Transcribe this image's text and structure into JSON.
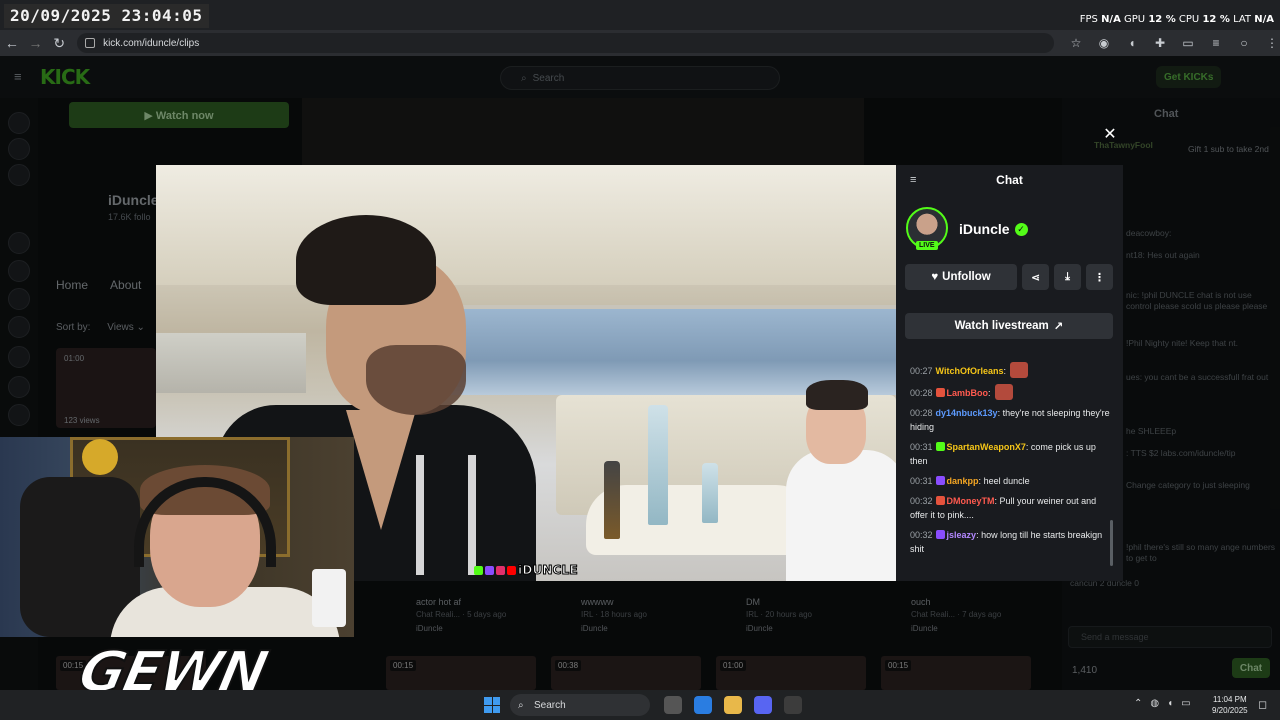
{
  "overlay": {
    "clock": "20/09/2025 23:04:05",
    "stats": {
      "fps_label": "FPS",
      "fps_value": "N/A",
      "gpu_label": "GPU",
      "gpu_value": "12 %",
      "cpu_label": "CPU",
      "cpu_value": "12 %",
      "lat_label": "LAT",
      "lat_value": "N/A"
    },
    "brand_text": "GEWN"
  },
  "browser": {
    "url": "kick.com/iduncle/clips"
  },
  "background_page": {
    "search_placeholder": "Search",
    "get_kicks": "Get KICKs",
    "watch_now": "▶ Watch now",
    "channel_name": "iDuncle",
    "channel_sub": "17.6K follo",
    "tabs": [
      "Home",
      "About"
    ],
    "sort_label": "Sort by:",
    "sort_value": "Views",
    "clip_duration_top": "01:00",
    "clip_views": "123 views",
    "clips": [
      {
        "title": "actor hot af",
        "meta": "Chat Reali... · 5 days ago",
        "author": "iDuncle"
      },
      {
        "title": "wwwww",
        "meta": "IRL · 18 hours ago",
        "author": "iDuncle"
      },
      {
        "title": "DM",
        "meta": "IRL · 20 hours ago",
        "author": "iDuncle"
      },
      {
        "title": "ouch",
        "meta": "Chat Reali... · 7 days ago",
        "author": "iDuncle"
      }
    ],
    "thumb_durations": [
      "00:15",
      "00:15",
      "00:38",
      "01:00",
      "00:15"
    ],
    "right_chat": {
      "title": "Chat",
      "gift_text": "Gift 1 sub to take 2nd",
      "top_user": "ThaTawnyFool",
      "messages": [
        "deacowboy:",
        "nt18: Hes out again",
        "nic: !phil DUNCLE chat is not use control please scold us please please",
        "!Phil Nighty nite! Keep that nt.",
        "ues: you cant be a successfull frat out",
        "he SHLEEEp",
        ": TTS $2 labs.com/iduncle/tip",
        "Change category to just sleeping",
        "!phil there's still so many ange numbers to get to",
        "cancun 2 duncle 0"
      ],
      "send_placeholder": "Send a message",
      "viewer_count": "1,410",
      "chat_button": "Chat"
    }
  },
  "modal": {
    "video_watermark": "iDUNCLE",
    "chat": {
      "title": "Chat",
      "channel_name": "iDuncle",
      "live_badge": "LIVE",
      "unfollow_label": "Unfollow",
      "watch_livestream_label": "Watch livestream",
      "messages": [
        {
          "ts": "00:27",
          "user": "WitchOfOrleans",
          "color": "#f5c518",
          "badge_color": "",
          "text": "",
          "emote": true
        },
        {
          "ts": "00:28",
          "user": "LambBoo",
          "color": "#ff5a4f",
          "badge_color": "#e5533d",
          "text": "",
          "emote": true
        },
        {
          "ts": "00:28",
          "user": "dy14nbuck13y",
          "color": "#5d9bff",
          "badge_color": "",
          "text": "they're not sleeping they're hiding",
          "emote": false
        },
        {
          "ts": "00:31",
          "user": "SpartanWeaponX7",
          "color": "#f5c518",
          "badge_color": "#53fc18",
          "text": "come pick us up then",
          "emote": false
        },
        {
          "ts": "00:31",
          "user": "dankpp",
          "color": "#f5a623",
          "badge_color": "#8a4dff",
          "text": "heel duncle",
          "emote": false
        },
        {
          "ts": "00:32",
          "user": "DMoneyTM",
          "color": "#ff5a4f",
          "badge_color": "#e5533d",
          "text": "Pull your weiner out and offer it to pink....",
          "emote": false
        },
        {
          "ts": "00:32",
          "user": "jsleazy",
          "color": "#b388ff",
          "badge_color": "#8a4dff",
          "text": "how long till he starts breakign shit",
          "emote": false
        }
      ]
    }
  },
  "taskbar": {
    "search_label": "Search",
    "time": "11:04 PM",
    "date": "9/20/2025"
  },
  "colors": {
    "kick_green": "#53fc18",
    "panel_bg": "#191b1f",
    "button_bg": "#2f3237"
  }
}
